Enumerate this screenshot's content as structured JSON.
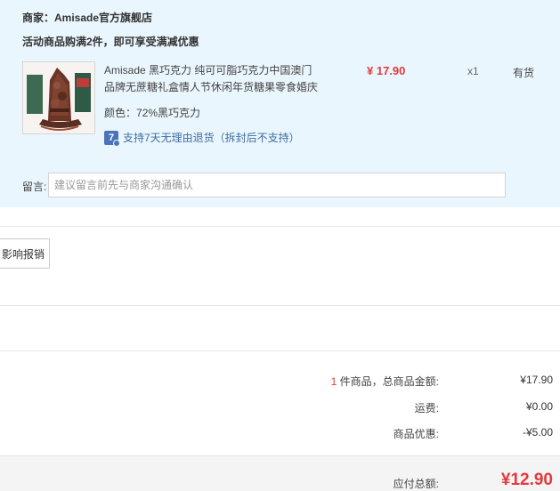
{
  "shop": {
    "merchant_label": "商家：",
    "merchant_name": "Amisade官方旗舰店",
    "promo_text": "活动商品购满2件，即可享受满减优惠"
  },
  "item": {
    "title": "Amisade 黑巧克力 纯可可脂巧克力中国澳门品牌无蔗糖礼盒情人节休闲年货糖果零食婚庆",
    "price": "¥ 17.90",
    "quantity": "x1",
    "stock_status": "有货",
    "color_label": "颜色：",
    "color_value": "72%黑巧克力",
    "return_badge": "7",
    "return_policy": "支持7天无理由退货（拆封后不支持）"
  },
  "note": {
    "label": "留言:",
    "placeholder": "建议留言前先与商家沟通确认"
  },
  "invoice": {
    "button_label": "影响报销"
  },
  "summary": {
    "count": "1",
    "count_suffix": " 件商品，总商品金额:",
    "goods_amount": "¥17.90",
    "shipping_label": "运费:",
    "shipping_value": "¥0.00",
    "discount_label": "商品优惠:",
    "discount_value": "-¥5.00",
    "total_label": "应付总额:",
    "total_value": "¥12.90"
  },
  "colors": {
    "accent_red": "#e4393c",
    "panel_bg": "#eaf6fd",
    "link_blue": "#3e6ea3"
  }
}
